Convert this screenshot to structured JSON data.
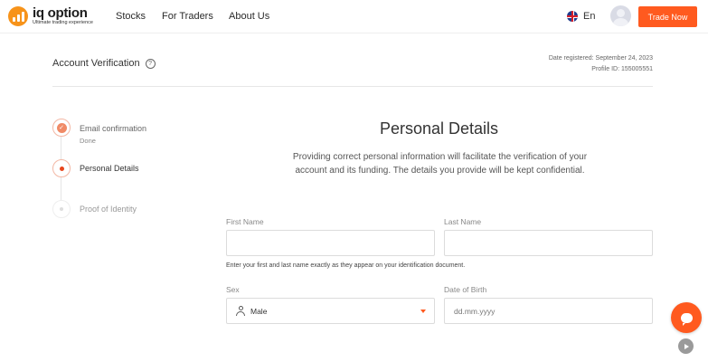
{
  "nav": {
    "logo_title": "iq option",
    "logo_subtitle": "Ultimate trading experience",
    "links": [
      "Stocks",
      "For Traders",
      "About Us"
    ],
    "language": "En",
    "trade_button": "Trade Now",
    "accent_color": "#ff5a1f"
  },
  "header": {
    "title": "Account Verification",
    "help_glyph": "?",
    "date_registered": "Date registered: September 24, 2023",
    "profile_id": "Profile ID: 155005551"
  },
  "steps": [
    {
      "label": "Email confirmation",
      "status_text": "Done",
      "state": "done"
    },
    {
      "label": "Personal Details",
      "state": "active"
    },
    {
      "label": "Proof of Identity",
      "state": "todo"
    }
  ],
  "form": {
    "title": "Personal Details",
    "description": "Providing correct personal information will facilitate the verification of your account and its funding. The details you provide will be kept confidential.",
    "first_name_label": "First Name",
    "first_name_value": "",
    "last_name_label": "Last Name",
    "last_name_value": "",
    "name_hint": "Enter your first and last name exactly as they appear on your identification document.",
    "sex_label": "Sex",
    "sex_value": "Male",
    "dob_label": "Date of Birth",
    "dob_placeholder": "dd.mm.yyyy"
  },
  "icons": {
    "check": "✓",
    "chat": "chat-icon",
    "play": "play-icon"
  }
}
